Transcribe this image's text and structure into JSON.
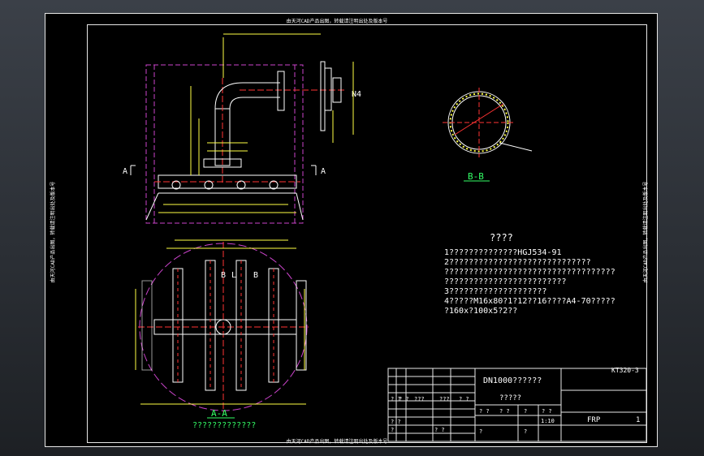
{
  "drawing": {
    "top_banner": "由天河CAD产品出图，转载请注明出处及版本号",
    "bottom_banner": "由天河CAD产品出图，转载请注明出处及版本号",
    "left_banner": "由天河CAD产品出图，转载请注明出处及版本号",
    "right_banner": "由天河CAD产品出图，转载请注明出处及版本号",
    "nozzle_label": "N4",
    "section_a_left": "A",
    "section_a_right": "A",
    "section_bb_title": "B-B",
    "section_aa_title": "A-A",
    "section_aa_caption": "?????????????",
    "label_b_left": "B",
    "label_b_right": "B",
    "label_l": "L",
    "notes_title": "????",
    "notes": [
      "1??????????????HGJ534-91",
      "2?????????????????????????????",
      "???????????????????????????????????",
      "?????????????????????????",
      "3????????????????????",
      "4?????M16x80?1?12??16????A4-70?????",
      "?160x?100x5?2??"
    ]
  },
  "title_block": {
    "drawing_no": "KT320-3",
    "title": "DN1000??????",
    "subtitle": "?????",
    "scale": "1:10",
    "material": "FRP",
    "sheet": "1",
    "cells_q": [
      "? ?",
      "? ?",
      "???",
      "???",
      "? ?",
      "? ?",
      "?",
      "? ?",
      "? ?",
      "? ?",
      "?",
      "? ?",
      "?",
      "?"
    ]
  },
  "colors": {
    "background": "#000000",
    "frame": "#e8e8e8",
    "pipe": "#ffffff",
    "centerline": "#ff3333",
    "hidden": "#cc44cc",
    "dimension": "#ffff44",
    "section": "#33ff66",
    "nozzle": "#44ccff"
  }
}
